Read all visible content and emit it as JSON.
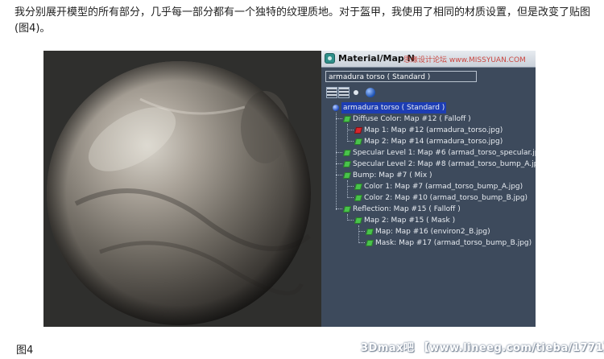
{
  "article": {
    "intro_text": "我分别展开模型的所有部分，几乎每一部分都有一个独特的纹理质地。对于盔甲，我使用了相同的材质设置，但是改变了贴图(图4)。",
    "figure_caption": "图4",
    "bottom_watermark": "3Dmax吧 【www.lineeg.com/tieba/1771】"
  },
  "panel": {
    "title": "Material/Map N",
    "title_watermark": "思缘设计论坛  www.MISSYUAN.COM",
    "name_field": "armadura torso  ( Standard )",
    "tree": [
      {
        "label": "armadura torso  ( Standard )",
        "icon": "material-sphere-icon",
        "selected": true
      },
      {
        "label": "Diffuse Color: Map #12  ( Falloff )",
        "icon": "map-icon"
      },
      {
        "label": "Map 1: Map #12 (armadura_torso.jpg)",
        "icon": "map-icon-red"
      },
      {
        "label": "Map 2: Map #14 (armadura_torso.jpg)",
        "icon": "map-icon"
      },
      {
        "label": "Specular Level 1: Map #6 (armad_torso_specular.jpg)",
        "icon": "map-icon"
      },
      {
        "label": "Specular Level 2: Map #8 (armad_torso_bump_A.jpg)",
        "icon": "map-icon"
      },
      {
        "label": "Bump: Map #7  ( Mix )",
        "icon": "map-icon"
      },
      {
        "label": "Color 1: Map #7 (armad_torso_bump_A.jpg)",
        "icon": "map-icon"
      },
      {
        "label": "Color 2: Map #10 (armad_torso_bump_B.jpg)",
        "icon": "map-icon"
      },
      {
        "label": "Reflection: Map #15  ( Falloff )",
        "icon": "map-icon"
      },
      {
        "label": "Map 2: Map #15  ( Mask )",
        "icon": "map-icon"
      },
      {
        "label": "Map: Map #16 (environ2_B.jpg)",
        "icon": "map-icon"
      },
      {
        "label": "Mask: Map #17 (armad_torso_bump_B.jpg)",
        "icon": "map-icon"
      }
    ]
  },
  "colors": {
    "panel_bg": "#3d4a5c",
    "selection": "#1d3db3",
    "map_icon": "#49c34b",
    "map_icon_red": "#d8262c"
  }
}
